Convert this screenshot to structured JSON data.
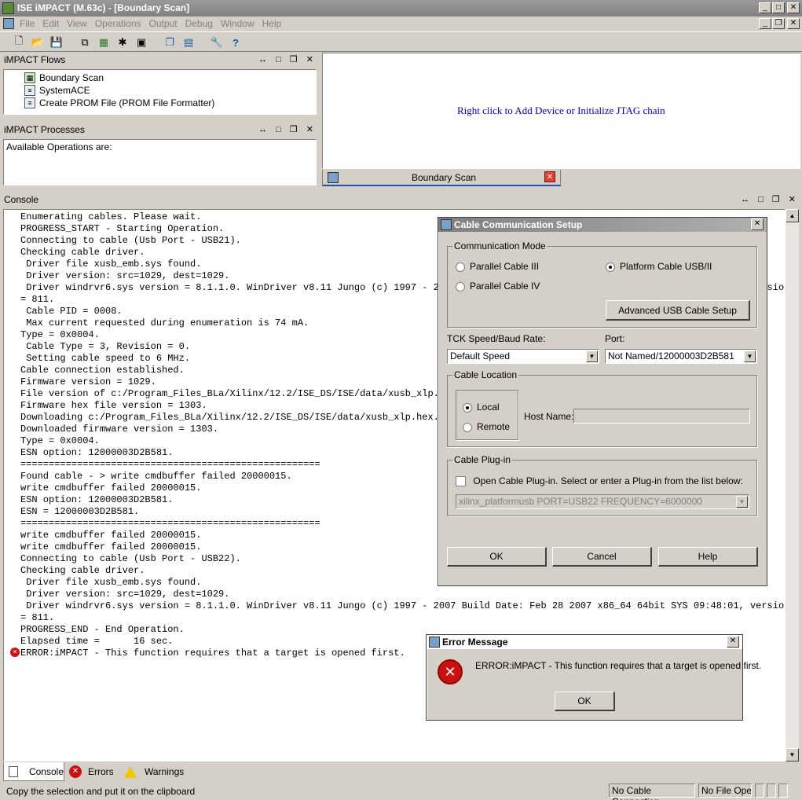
{
  "window": {
    "title": "ISE iMPACT (M.63c) - [Boundary Scan]"
  },
  "menu": [
    "File",
    "Edit",
    "View",
    "Operations",
    "Output",
    "Debug",
    "Window",
    "Help"
  ],
  "flows_panel": {
    "title": "iMPACT Flows",
    "items": [
      "Boundary Scan",
      "SystemACE",
      "Create PROM File (PROM File Formatter)"
    ]
  },
  "processes_panel": {
    "title": "iMPACT Processes",
    "text": "Available Operations are:"
  },
  "canvas": {
    "hint": "Right click to Add Device or Initialize JTAG chain",
    "hint_color": "#0000cc",
    "tab_label": "Boundary Scan"
  },
  "console": {
    "title": "Console",
    "lines": [
      "Enumerating cables. Please wait.",
      "PROGRESS_START - Starting Operation.",
      "Connecting to cable (Usb Port - USB21).",
      "Checking cable driver.",
      " Driver file xusb_emb.sys found.",
      " Driver version: src=1029, dest=1029.",
      " Driver windrvr6.sys version = 8.1.1.0. WinDriver v8.11 Jungo (c) 1997 - 2007 Build Date: Feb 28 2007 x86_64 64bit SYS 09:48:01, version",
      "= 811.",
      " Cable PID = 0008.",
      " Max current requested during enumeration is 74 mA.",
      "Type = 0x0004.",
      " Cable Type = 3, Revision = 0.",
      " Setting cable speed to 6 MHz.",
      "Cable connection established.",
      "Firmware version = 1029.",
      "File version of c:/Program_Files_BLa/Xilinx/12.2/ISE_DS/ISE/data/xusb_xlp.hex = 1303.",
      "Firmware hex file version = 1303.",
      "Downloading c:/Program_Files_BLa/Xilinx/12.2/ISE_DS/ISE/data/xusb_xlp.hex.",
      "Downloaded firmware version = 1303.",
      "Type = 0x0004.",
      "ESN option: 12000003D2B581.",
      "=====================================================",
      "Found cable - > write cmdbuffer failed 20000015.",
      "write cmdbuffer failed 20000015.",
      "ESN option: 12000003D2B581.",
      "ESN = 12000003D2B581.",
      "=====================================================",
      "write cmdbuffer failed 20000015.",
      "write cmdbuffer failed 20000015.",
      "Connecting to cable (Usb Port - USB22).",
      "Checking cable driver.",
      " Driver file xusb_emb.sys found.",
      " Driver version: src=1029, dest=1029.",
      " Driver windrvr6.sys version = 8.1.1.0. WinDriver v8.11 Jungo (c) 1997 - 2007 Build Date: Feb 28 2007 x86_64 64bit SYS 09:48:01, version",
      "= 811.",
      "PROGRESS_END - End Operation.",
      "Elapsed time =      16 sec.",
      "ERROR:iMPACT - This function requires that a target is opened first."
    ]
  },
  "bottom_tabs": [
    "Console",
    "Errors",
    "Warnings"
  ],
  "status": {
    "message": "Copy the selection and put it on the clipboard",
    "cable": "No Cable Connection",
    "file": "No File Open"
  },
  "cable_dialog": {
    "title": "Cable Communication Setup",
    "comm_mode_label": "Communication Mode",
    "opt_parallel3": "Parallel Cable III",
    "opt_parallel4": "Parallel Cable IV",
    "opt_platform_usb": "Platform Cable USB/II",
    "advanced_btn": "Advanced USB Cable Setup",
    "speed_label": "TCK Speed/Baud Rate:",
    "speed_value": "Default Speed",
    "port_label": "Port:",
    "port_value": "Not Named/12000003D2B581",
    "location_label": "Cable Location",
    "opt_local": "Local",
    "opt_remote": "Remote",
    "host_label": "Host Name:",
    "plugin_label": "Cable Plug-in",
    "plugin_check": "Open Cable Plug-in. Select or enter a Plug-in from the list below:",
    "plugin_value": "xilinx_platformusb PORT=USB22 FREQUENCY=6000000",
    "ok": "OK",
    "cancel": "Cancel",
    "help": "Help"
  },
  "error_dialog": {
    "title": "Error Message",
    "message": "ERROR:iMPACT - This function requires that a target is opened first.",
    "ok": "OK"
  },
  "colors": {
    "error_red": "#cc1010",
    "link_blue": "#0000cc"
  }
}
